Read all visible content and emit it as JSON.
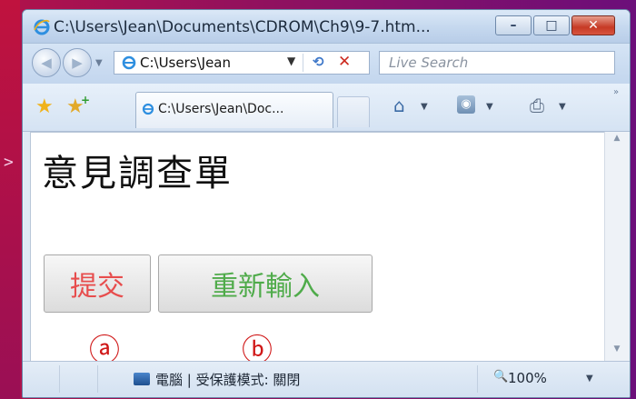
{
  "window": {
    "title": "C:\\Users\\Jean\\Documents\\CDROM\\Ch9\\9-7.htm...",
    "controls": {
      "minimize": "–",
      "maximize": "□",
      "close": "✕"
    }
  },
  "navigation": {
    "back_glyph": "◀",
    "forward_glyph": "▶",
    "address_value": "C:\\Users\\Jean",
    "search_placeholder": "Live Search"
  },
  "tab": {
    "label": "C:\\Users\\Jean\\Doc..."
  },
  "page": {
    "heading": "意見調查單",
    "submit_label": "提交",
    "reset_label": "重新輸入",
    "marker_a": "ⓐ",
    "marker_b": "ⓑ"
  },
  "status": {
    "zone_text": "電腦 | 受保護模式: 關閉",
    "zoom": "100%"
  },
  "slide": {
    "arrow": ">"
  },
  "colors": {
    "submit_text": "#e74d4d",
    "reset_text": "#4fab4a",
    "marker": "#d01818",
    "slide_background": "#8e1060"
  },
  "icons": [
    "ie-icon",
    "back-icon",
    "forward-icon",
    "refresh-icon",
    "stop-icon",
    "favorites-star-icon",
    "add-favorite-icon",
    "home-icon",
    "feeds-icon",
    "print-icon",
    "computer-zone-icon",
    "zoom-icon"
  ]
}
